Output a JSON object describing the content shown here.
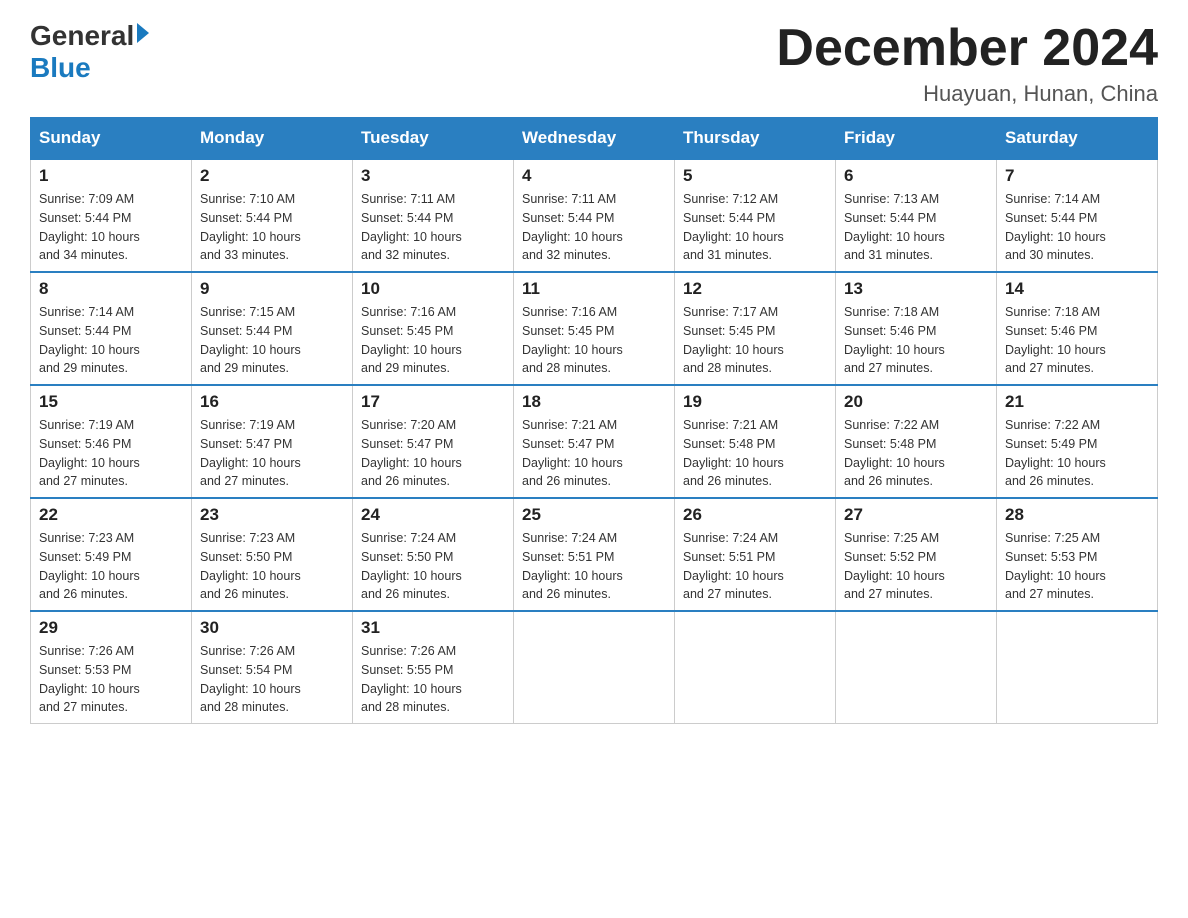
{
  "header": {
    "logo_general": "General",
    "logo_blue": "Blue",
    "month_title": "December 2024",
    "subtitle": "Huayuan, Hunan, China"
  },
  "weekdays": [
    "Sunday",
    "Monday",
    "Tuesday",
    "Wednesday",
    "Thursday",
    "Friday",
    "Saturday"
  ],
  "weeks": [
    [
      {
        "day": "1",
        "sunrise": "7:09 AM",
        "sunset": "5:44 PM",
        "daylight": "10 hours and 34 minutes."
      },
      {
        "day": "2",
        "sunrise": "7:10 AM",
        "sunset": "5:44 PM",
        "daylight": "10 hours and 33 minutes."
      },
      {
        "day": "3",
        "sunrise": "7:11 AM",
        "sunset": "5:44 PM",
        "daylight": "10 hours and 32 minutes."
      },
      {
        "day": "4",
        "sunrise": "7:11 AM",
        "sunset": "5:44 PM",
        "daylight": "10 hours and 32 minutes."
      },
      {
        "day": "5",
        "sunrise": "7:12 AM",
        "sunset": "5:44 PM",
        "daylight": "10 hours and 31 minutes."
      },
      {
        "day": "6",
        "sunrise": "7:13 AM",
        "sunset": "5:44 PM",
        "daylight": "10 hours and 31 minutes."
      },
      {
        "day": "7",
        "sunrise": "7:14 AM",
        "sunset": "5:44 PM",
        "daylight": "10 hours and 30 minutes."
      }
    ],
    [
      {
        "day": "8",
        "sunrise": "7:14 AM",
        "sunset": "5:44 PM",
        "daylight": "10 hours and 29 minutes."
      },
      {
        "day": "9",
        "sunrise": "7:15 AM",
        "sunset": "5:44 PM",
        "daylight": "10 hours and 29 minutes."
      },
      {
        "day": "10",
        "sunrise": "7:16 AM",
        "sunset": "5:45 PM",
        "daylight": "10 hours and 29 minutes."
      },
      {
        "day": "11",
        "sunrise": "7:16 AM",
        "sunset": "5:45 PM",
        "daylight": "10 hours and 28 minutes."
      },
      {
        "day": "12",
        "sunrise": "7:17 AM",
        "sunset": "5:45 PM",
        "daylight": "10 hours and 28 minutes."
      },
      {
        "day": "13",
        "sunrise": "7:18 AM",
        "sunset": "5:46 PM",
        "daylight": "10 hours and 27 minutes."
      },
      {
        "day": "14",
        "sunrise": "7:18 AM",
        "sunset": "5:46 PM",
        "daylight": "10 hours and 27 minutes."
      }
    ],
    [
      {
        "day": "15",
        "sunrise": "7:19 AM",
        "sunset": "5:46 PM",
        "daylight": "10 hours and 27 minutes."
      },
      {
        "day": "16",
        "sunrise": "7:19 AM",
        "sunset": "5:47 PM",
        "daylight": "10 hours and 27 minutes."
      },
      {
        "day": "17",
        "sunrise": "7:20 AM",
        "sunset": "5:47 PM",
        "daylight": "10 hours and 26 minutes."
      },
      {
        "day": "18",
        "sunrise": "7:21 AM",
        "sunset": "5:47 PM",
        "daylight": "10 hours and 26 minutes."
      },
      {
        "day": "19",
        "sunrise": "7:21 AM",
        "sunset": "5:48 PM",
        "daylight": "10 hours and 26 minutes."
      },
      {
        "day": "20",
        "sunrise": "7:22 AM",
        "sunset": "5:48 PM",
        "daylight": "10 hours and 26 minutes."
      },
      {
        "day": "21",
        "sunrise": "7:22 AM",
        "sunset": "5:49 PM",
        "daylight": "10 hours and 26 minutes."
      }
    ],
    [
      {
        "day": "22",
        "sunrise": "7:23 AM",
        "sunset": "5:49 PM",
        "daylight": "10 hours and 26 minutes."
      },
      {
        "day": "23",
        "sunrise": "7:23 AM",
        "sunset": "5:50 PM",
        "daylight": "10 hours and 26 minutes."
      },
      {
        "day": "24",
        "sunrise": "7:24 AM",
        "sunset": "5:50 PM",
        "daylight": "10 hours and 26 minutes."
      },
      {
        "day": "25",
        "sunrise": "7:24 AM",
        "sunset": "5:51 PM",
        "daylight": "10 hours and 26 minutes."
      },
      {
        "day": "26",
        "sunrise": "7:24 AM",
        "sunset": "5:51 PM",
        "daylight": "10 hours and 27 minutes."
      },
      {
        "day": "27",
        "sunrise": "7:25 AM",
        "sunset": "5:52 PM",
        "daylight": "10 hours and 27 minutes."
      },
      {
        "day": "28",
        "sunrise": "7:25 AM",
        "sunset": "5:53 PM",
        "daylight": "10 hours and 27 minutes."
      }
    ],
    [
      {
        "day": "29",
        "sunrise": "7:26 AM",
        "sunset": "5:53 PM",
        "daylight": "10 hours and 27 minutes."
      },
      {
        "day": "30",
        "sunrise": "7:26 AM",
        "sunset": "5:54 PM",
        "daylight": "10 hours and 28 minutes."
      },
      {
        "day": "31",
        "sunrise": "7:26 AM",
        "sunset": "5:55 PM",
        "daylight": "10 hours and 28 minutes."
      },
      null,
      null,
      null,
      null
    ]
  ],
  "labels": {
    "sunrise": "Sunrise:",
    "sunset": "Sunset:",
    "daylight": "Daylight:"
  }
}
